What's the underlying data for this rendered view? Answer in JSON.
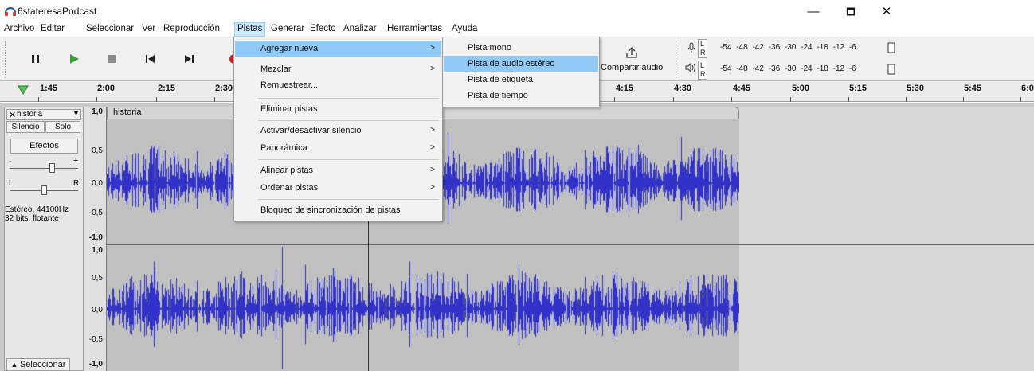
{
  "window": {
    "title": "6stateresaPodcast",
    "minimize": "—",
    "maximize": "🗖",
    "close": "✕"
  },
  "menubar": [
    "Archivo",
    "Editar",
    "Seleccionar",
    "Ver",
    "Reproducción",
    "Pistas",
    "Generar",
    "Efecto",
    "Analizar",
    "Herramientas",
    "Ayuda"
  ],
  "toolbar": {
    "share_label": "Compartir audio",
    "meter_scale": "-54 -48 -42 -36 -30 -24 -18 -12 -6",
    "meter_L": "L",
    "meter_R": "R"
  },
  "ruler": {
    "labels": [
      "1:45",
      "2:00",
      "2:15",
      "2:30",
      "4:15",
      "4:30",
      "4:45",
      "5:00",
      "5:15",
      "5:30",
      "5:45",
      "6:0"
    ]
  },
  "track": {
    "name": "historia",
    "clip_name": "historia",
    "mute": "Silencio",
    "solo": "Solo",
    "effects": "Efectos",
    "gain_minus": "-",
    "gain_plus": "+",
    "pan_L": "L",
    "pan_R": "R",
    "info1": "Estéreo, 44100Hz",
    "info2": "32 bits, flotante",
    "select": "Seleccionar",
    "scale": [
      "1,0",
      "0,5",
      "0,0",
      "-0,5",
      "-1,0",
      "1,0",
      "0,5",
      "0,0",
      "-0,5",
      "-1,0"
    ]
  },
  "menu_pistas": {
    "items": [
      "Agregar nueva",
      "Mezclar",
      "Remuestrear...",
      "Eliminar pistas",
      "Activar/desactivar silencio",
      "Panorámica",
      "Alinear pistas",
      "Ordenar pistas",
      "Bloqueo de sincronización de pistas"
    ]
  },
  "submenu_agregar": {
    "items": [
      "Pista mono",
      "Pista de audio estéreo",
      "Pista de etiqueta",
      "Pista de tiempo"
    ]
  },
  "colors": {
    "accent": "#91c9f7",
    "wave": "#3232c8",
    "menu_active": "#cce8ff"
  }
}
